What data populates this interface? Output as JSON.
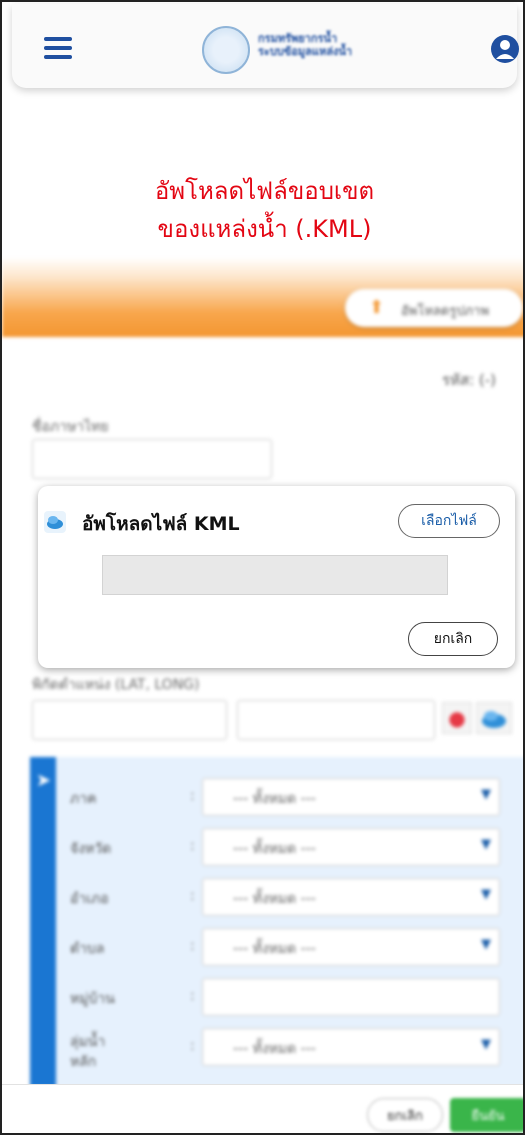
{
  "header": {
    "menu_icon": "hamburger-menu-icon",
    "logo_icon": "water-department-seal-logo",
    "logo_text_line1": "กรมทรัพยากรน้ำ",
    "logo_text_line2": "ระบบข้อมูลแหล่งน้ำ",
    "user_icon": "user-account-icon",
    "brand_color": "#1f4fa0"
  },
  "page": {
    "title_line1": "อัพโหลดไฟล์ขอบเขต",
    "title_line2": "ของแหล่งน้ำ (.KML)",
    "title_color": "#e30613",
    "upload_picture_label": "อัพโหลดรูปภาพ",
    "code_label": "รหัส: (-)",
    "name_th_label": "ชื่อภาษาไทย",
    "coord_label": "พิกัดตำแหน่ง (LAT, LONG)",
    "location_rows": [
      {
        "label": "ภาค",
        "value": "--- ทั้งหมด ---"
      },
      {
        "label": "จังหวัด",
        "value": "--- ทั้งหมด ---"
      },
      {
        "label": "อำเภอ",
        "value": "--- ทั้งหมด ---"
      },
      {
        "label": "ตำบล",
        "value": "--- ทั้งหมด ---"
      },
      {
        "label": "หมู่บ้าน",
        "value": ""
      },
      {
        "label": "ลุ่มน้ำหลัก",
        "value": "--- ทั้งหมด ---"
      }
    ]
  },
  "modal": {
    "icon": "kml-cloud-icon",
    "title": "อัพโหลดไฟล์ KML",
    "choose_file_label": "เลือกไฟล์",
    "cancel_label": "ยกเลิก",
    "file_name_value": ""
  },
  "footer": {
    "cancel_label": "ยกเลิก",
    "confirm_label": "ยืนยัน",
    "confirm_color": "#3ab54a"
  }
}
